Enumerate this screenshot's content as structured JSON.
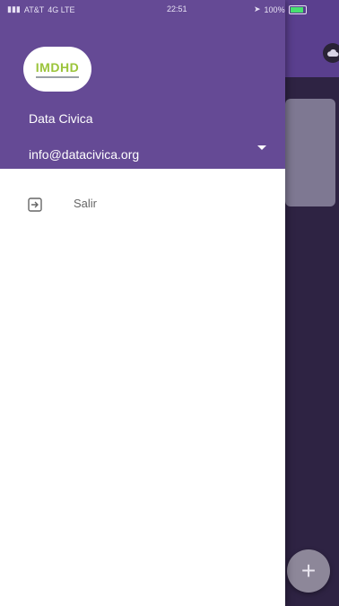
{
  "status_bar": {
    "carrier": "AT&T",
    "network": "4G LTE",
    "time": "22:51",
    "battery": "100%"
  },
  "header": {
    "logo_text": "IMDHD",
    "account_name": "Data Civica",
    "account_email": "info@datacivica.org"
  },
  "menu": {
    "items": [
      {
        "label": "Salir",
        "icon": "logout-icon"
      }
    ]
  },
  "background_app": {
    "fab_label": "+"
  },
  "colors": {
    "header_purple": "#654a95",
    "dark_purple": "#2e2343",
    "logo_green": "#9bc43a"
  }
}
